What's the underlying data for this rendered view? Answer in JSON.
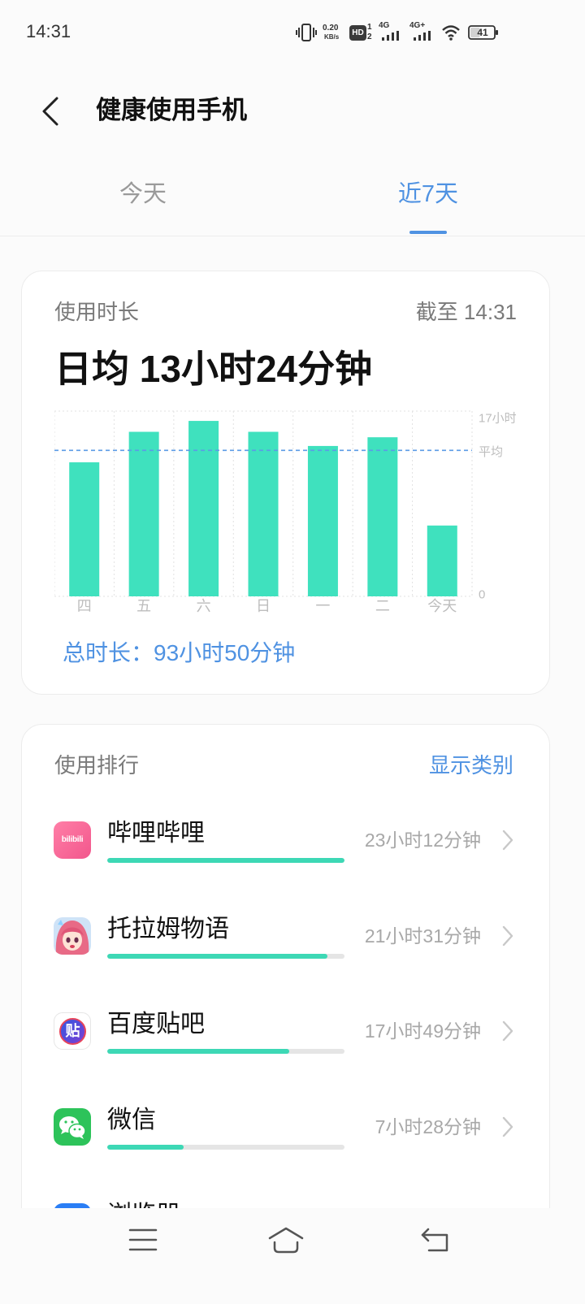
{
  "status_bar": {
    "time": "14:31",
    "net_speed": "0.20",
    "net_speed_unit": "KB/s",
    "hd_badge": "HD",
    "sim_slot_1": "1",
    "sim_slot_2": "2",
    "network_1": "4G",
    "network_2": "4G+",
    "battery": "41",
    "icons": {
      "vibrate": "vibrate-icon",
      "signal": "signal-bars-icon",
      "wifi": "wifi-icon",
      "battery": "battery-icon"
    }
  },
  "header": {
    "title": "健康使用手机",
    "back_icon": "back-arrow-icon"
  },
  "tabs": [
    {
      "label": "今天",
      "active": false
    },
    {
      "label": "近7天",
      "active": true
    }
  ],
  "usage_card": {
    "title": "使用时长",
    "as_of": "截至 14:31",
    "daily_average": "日均 13小时24分钟",
    "total": "总时长：93小时50分钟"
  },
  "chart_data": {
    "type": "bar",
    "categories": [
      "四",
      "五",
      "六",
      "日",
      "一",
      "二",
      "今天"
    ],
    "values": [
      12.3,
      15.1,
      16.1,
      15.1,
      13.8,
      14.6,
      6.5
    ],
    "ylim": [
      0,
      17
    ],
    "y_ticks": [
      {
        "value": 0,
        "label": "0"
      },
      {
        "value": 17,
        "label": "17小时"
      }
    ],
    "average": {
      "value": 13.4,
      "label": "平均"
    },
    "grid": true,
    "colors": {
      "bar": "#3fe1be",
      "average_line": "#5b9be6",
      "grid": "#e2e2e2",
      "label": "#bdbdbd"
    }
  },
  "ranking": {
    "title": "使用排行",
    "toggle_label": "显示类别",
    "items": [
      {
        "name": "哔哩哔哩",
        "duration": "23小时12分钟",
        "share": 1.0,
        "icon": "bilibili-app-icon",
        "icon_text": "bilibili"
      },
      {
        "name": "托拉姆物语",
        "duration": "21小时31分钟",
        "share": 0.928,
        "icon": "toram-online-app-icon"
      },
      {
        "name": "百度贴吧",
        "duration": "17小时49分钟",
        "share": 0.768,
        "icon": "baidu-tieba-app-icon",
        "icon_text": "贴"
      },
      {
        "name": "微信",
        "duration": "7小时28分钟",
        "share": 0.322,
        "icon": "wechat-app-icon"
      },
      {
        "name": "浏览器",
        "icon": "browser-app-icon"
      }
    ]
  },
  "nav_bar": {
    "icons": [
      "menu-icon",
      "home-icon",
      "back-icon"
    ]
  },
  "colors": {
    "accent": "#4f92e2",
    "progress": "#3dd8b5",
    "progress_track": "#e5e5e5",
    "text_primary": "#111111",
    "text_secondary": "#7a7a7a"
  }
}
